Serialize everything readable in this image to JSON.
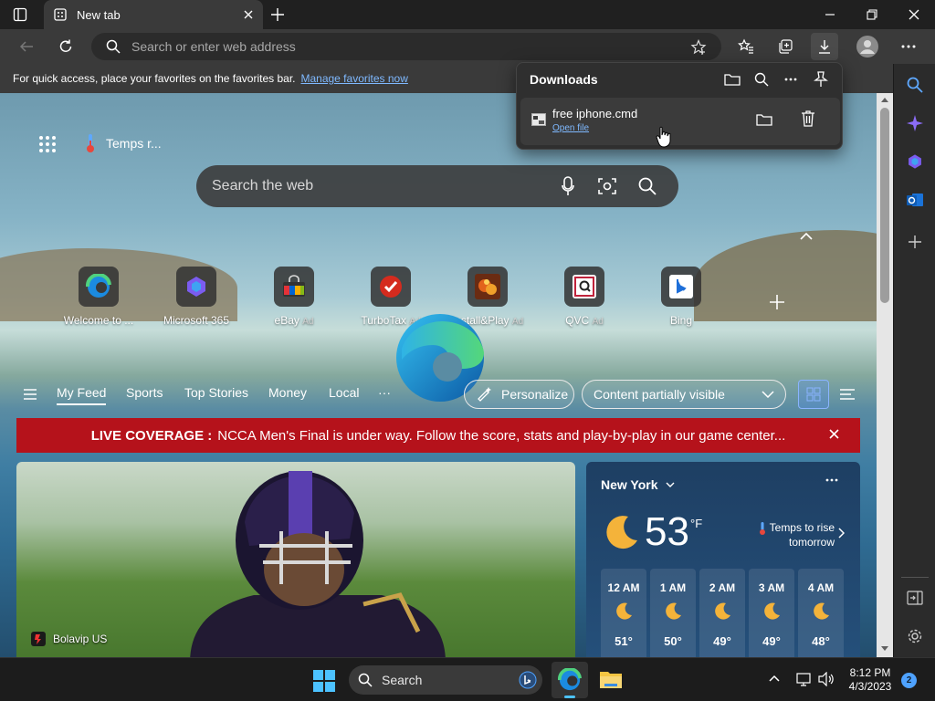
{
  "browser": {
    "tab_title": "New tab",
    "address_placeholder": "Search or enter web address",
    "favorites_bar_text": "For quick access, place your favorites on the favorites bar.",
    "favorites_bar_link": "Manage favorites now"
  },
  "downloads": {
    "title": "Downloads",
    "item_name": "free iphone.cmd",
    "item_action": "Open file"
  },
  "newtab": {
    "weather_chip": "Temps r...",
    "search_placeholder": "Search the web",
    "tiles": [
      {
        "label": "Welcome to ...",
        "ad": ""
      },
      {
        "label": "Microsoft 365",
        "ad": ""
      },
      {
        "label": "eBay",
        "ad": "Ad"
      },
      {
        "label": "TurboTax",
        "ad": "Ad"
      },
      {
        "label": "Install&Play",
        "ad": "Ad"
      },
      {
        "label": "QVC",
        "ad": "Ad"
      },
      {
        "label": "Bing",
        "ad": ""
      }
    ],
    "feed_tabs": [
      "My Feed",
      "Sports",
      "Top Stories",
      "Money",
      "Local",
      "···"
    ],
    "personalize": "Personalize",
    "content_visibility": "Content partially visible",
    "live_label": "LIVE COVERAGE :",
    "live_text": "NCCA Men's Final is under way. Follow the score, stats and play-by-play in our game center...",
    "story_source": "Bolavip US"
  },
  "weather": {
    "city": "New York",
    "temp": "53",
    "unit": "°F",
    "note_line1": "Temps to rise",
    "note_line2": "tomorrow",
    "hours": [
      {
        "time": "12 AM",
        "temp": "51°"
      },
      {
        "time": "1 AM",
        "temp": "50°"
      },
      {
        "time": "2 AM",
        "temp": "49°"
      },
      {
        "time": "3 AM",
        "temp": "49°"
      },
      {
        "time": "4 AM",
        "temp": "48°"
      }
    ]
  },
  "taskbar": {
    "search_label": "Search",
    "time": "8:12 PM",
    "date": "4/3/2023",
    "notification_count": "2"
  },
  "colors": {
    "live_banner": "#b5121b",
    "link": "#7fb9ff",
    "accent": "#4ea2ff"
  }
}
